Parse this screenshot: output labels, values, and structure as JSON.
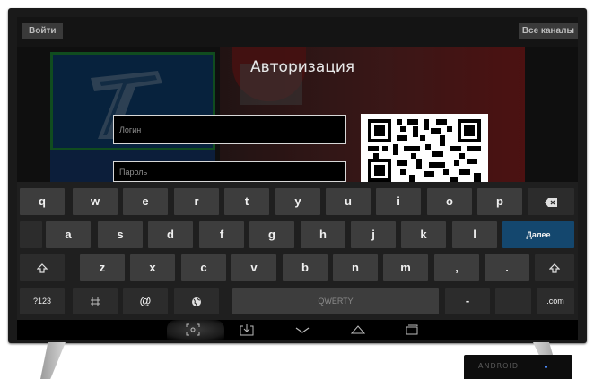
{
  "top_bar": {
    "login_label": "Войти",
    "channels_label": "Все каналы"
  },
  "auth": {
    "title": "Авторизация",
    "login_placeholder": "Логин",
    "password_placeholder": "Пароль"
  },
  "keyboard": {
    "row1": [
      "q",
      "w",
      "e",
      "r",
      "t",
      "y",
      "u",
      "i",
      "o",
      "p"
    ],
    "row2": [
      "a",
      "s",
      "d",
      "f",
      "g",
      "h",
      "j",
      "k",
      "l"
    ],
    "row3": [
      "z",
      "x",
      "c",
      "v",
      "b",
      "n",
      "m",
      ",",
      "."
    ],
    "next_label": "Далее",
    "symbols_label": "?123",
    "at_label": "@",
    "space_label": "QWERTY",
    "dash_label": "-",
    "underscore_label": "_",
    "dotcom_label": ".com",
    "icons": {
      "backspace": "backspace-icon",
      "shift": "shift-icon",
      "settings": "keyboard-settings-icon",
      "globe": "globe-icon"
    }
  },
  "nav": {
    "icons": [
      "screenshot-icon",
      "download-icon",
      "back-icon",
      "home-icon",
      "recents-icon"
    ]
  },
  "device": {
    "brand_mark": "ANDROID"
  },
  "colors": {
    "accent": "#14476e",
    "key_bg": "#3d3d3d",
    "keyboard_bg": "#1f1f1f"
  }
}
